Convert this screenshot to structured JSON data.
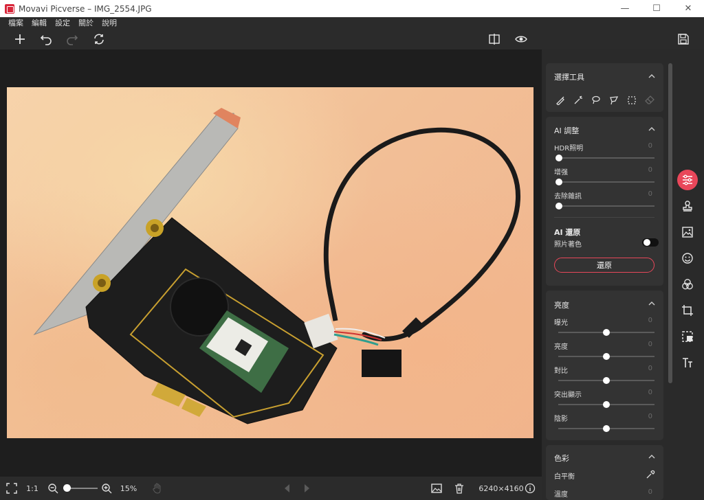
{
  "window": {
    "title": "Movavi Picverse – IMG_2554.JPG"
  },
  "menu": [
    "檔案",
    "編輯",
    "設定",
    "關於",
    "說明"
  ],
  "panel": {
    "selection": {
      "title": "選擇工具"
    },
    "ai_adjust": {
      "title": "AI 調整",
      "sliders": [
        {
          "label": "HDR照明",
          "value": "0"
        },
        {
          "label": "增强",
          "value": "0"
        },
        {
          "label": "去除雜訊",
          "value": "0"
        }
      ]
    },
    "ai_restore": {
      "title": "AI 還原",
      "colorize_label": "照片著色",
      "colorize_on": false,
      "button": "還原"
    },
    "brightness": {
      "title": "亮度",
      "sliders": [
        {
          "label": "曝光",
          "value": "0",
          "level": 0.5
        },
        {
          "label": "亮度",
          "value": "0",
          "level": 0.5
        },
        {
          "label": "對比",
          "value": "0",
          "level": 0.5
        },
        {
          "label": "突出顯示",
          "value": "0",
          "level": 0.5
        },
        {
          "label": "陰影",
          "value": "0",
          "level": 0.5
        }
      ]
    },
    "color": {
      "title": "色彩",
      "white_balance": "白平衡",
      "temperature": {
        "label": "溫度",
        "value": "0"
      }
    }
  },
  "bottom": {
    "ratio": "1:1",
    "zoom": "15%",
    "dimensions": "6240×4160"
  },
  "colors": {
    "accent": "#e9475a"
  }
}
